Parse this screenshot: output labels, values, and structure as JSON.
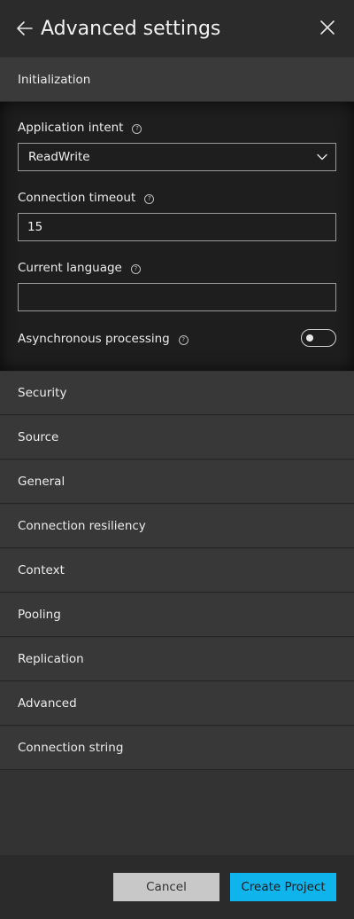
{
  "header": {
    "title": "Advanced settings",
    "back_icon": "arrow-left-icon",
    "close_icon": "close-icon"
  },
  "sections": {
    "initialization": {
      "label": "Initialization",
      "fields": {
        "application_intent": {
          "label": "Application intent",
          "selected": "ReadWrite"
        },
        "connection_timeout": {
          "label": "Connection timeout",
          "value": "15"
        },
        "current_language": {
          "label": "Current language",
          "value": ""
        },
        "asynchronous_processing": {
          "label": "Asynchronous processing",
          "enabled": false
        }
      }
    },
    "collapsed": [
      {
        "label": "Security"
      },
      {
        "label": "Source"
      },
      {
        "label": "General"
      },
      {
        "label": "Connection resiliency"
      },
      {
        "label": "Context"
      },
      {
        "label": "Pooling"
      },
      {
        "label": "Replication"
      },
      {
        "label": "Advanced"
      },
      {
        "label": "Connection string"
      }
    ]
  },
  "footer": {
    "cancel_label": "Cancel",
    "create_label": "Create Project"
  },
  "colors": {
    "accent": "#0fb4ec",
    "panel_bg": "#333333",
    "header_bg": "#2b2b2b",
    "expanded_bg": "#1e1e1e"
  }
}
